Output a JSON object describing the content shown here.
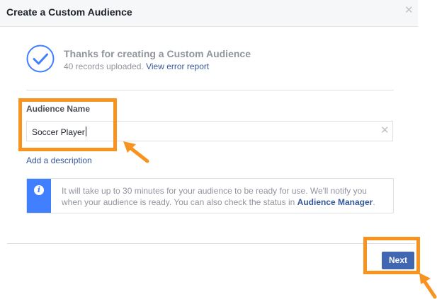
{
  "dialog": {
    "title": "Create a Custom Audience",
    "close_icon": "close-icon"
  },
  "success": {
    "icon": "check-circle-icon",
    "title": "Thanks for creating a Custom Audience",
    "records_text": "40 records uploaded.",
    "error_link": "View error report"
  },
  "form": {
    "name_label": "Audience Name",
    "name_value": "Soccer Player",
    "clear_icon": "clear-icon",
    "add_description": "Add a description"
  },
  "info": {
    "icon": "info-icon",
    "text_before": "It will take up to 30 minutes for your audience to be ready for use. We'll notify you when your audience is ready. You can also check the status in ",
    "link": "Audience Manager",
    "text_after": "."
  },
  "footer": {
    "next_label": "Next"
  },
  "annotations": {
    "highlight_color": "#f7931e",
    "accent_color": "#4267b2",
    "info_color": "#4080ff"
  }
}
